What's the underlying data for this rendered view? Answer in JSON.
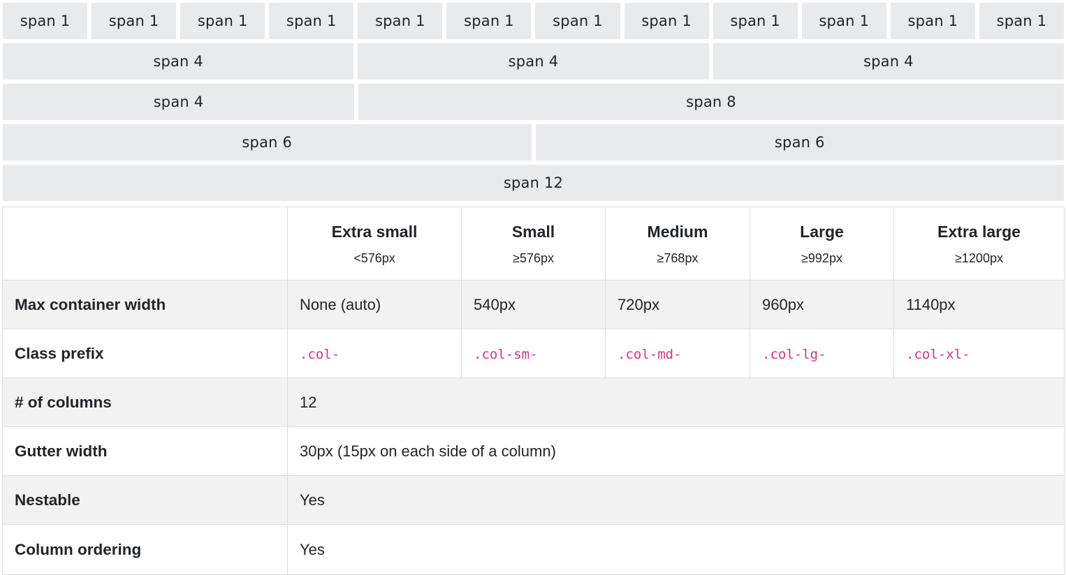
{
  "grid_demo": {
    "row1": [
      "span 1",
      "span 1",
      "span 1",
      "span 1",
      "span 1",
      "span 1",
      "span 1",
      "span 1",
      "span 1",
      "span 1",
      "span 1",
      "span 1"
    ],
    "row2": [
      "span 4",
      "span 4",
      "span 4"
    ],
    "row3": [
      "span 4",
      "span 8"
    ],
    "row4": [
      "span 6",
      "span 6"
    ],
    "row5": [
      "span 12"
    ]
  },
  "table": {
    "corner": "",
    "breakpoints": [
      {
        "name": "Extra small",
        "size": "<576px"
      },
      {
        "name": "Small",
        "size": "≥576px"
      },
      {
        "name": "Medium",
        "size": "≥768px"
      },
      {
        "name": "Large",
        "size": "≥992px"
      },
      {
        "name": "Extra large",
        "size": "≥1200px"
      }
    ],
    "max_container_width": {
      "label": "Max container width",
      "values": [
        "None (auto)",
        "540px",
        "720px",
        "960px",
        "1140px"
      ]
    },
    "class_prefix": {
      "label": "Class prefix",
      "values": [
        ".col-",
        ".col-sm-",
        ".col-md-",
        ".col-lg-",
        ".col-xl-"
      ]
    },
    "columns": {
      "label": "# of columns",
      "value": "12"
    },
    "gutter": {
      "label": "Gutter width",
      "value": "30px (15px on each side of a column)"
    },
    "nestable": {
      "label": "Nestable",
      "value": "Yes"
    },
    "ordering": {
      "label": "Column ordering",
      "value": "Yes"
    }
  },
  "colors": {
    "cell_bg": "#e9eaec",
    "stripe_bg": "#f2f2f2",
    "border": "#dcdee2",
    "code": "#d63384",
    "text": "#212529"
  }
}
